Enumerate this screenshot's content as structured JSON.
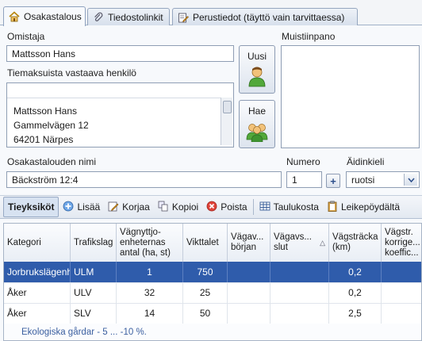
{
  "tabs": [
    {
      "label": "Osakastalous",
      "icon": "home-icon"
    },
    {
      "label": "Tiedostolinkit",
      "icon": "paperclip-icon"
    },
    {
      "label": "Perustiedot (täyttö vain tarvittaessa)",
      "icon": "edit-document-icon"
    }
  ],
  "owner": {
    "label": "Omistaja",
    "value": "Mattsson Hans"
  },
  "payer": {
    "label": "Tiemaksuista vastaava henkilö",
    "lines": [
      "Mattsson Hans",
      "Gammelvägen 12",
      "64201 Närpes"
    ]
  },
  "buttons": {
    "new": "Uusi",
    "fetch": "Hae"
  },
  "memo": {
    "label": "Muistiinpano",
    "value": ""
  },
  "household": {
    "label": "Osakastalouden nimi",
    "value": "Bäckström 12:4"
  },
  "number": {
    "label": "Numero",
    "value": "1"
  },
  "language": {
    "label": "Äidinkieli",
    "value": "ruotsi"
  },
  "toolbar": {
    "units": "Tieyksiköt",
    "add": "Lisää",
    "edit": "Korjaa",
    "copy": "Kopioi",
    "delete": "Poista",
    "from_table": "Taulukosta",
    "from_clipboard": "Leikepöydältä"
  },
  "grid": {
    "headers": [
      "Kategori",
      "Trafikslag",
      "Vägnyttjo-enheternas antal (ha, st)",
      "Vikttalet",
      "Vägav... början",
      "Vägavs... slut",
      "Vägsträcka (km)",
      "Vägstr. korrige... koeffic..."
    ],
    "rows": [
      [
        "Jorbrukslägenhet",
        "ULM",
        "1",
        "750",
        "",
        "",
        "0,2",
        ""
      ],
      [
        "Åker",
        "ULV",
        "32",
        "25",
        "",
        "",
        "0,2",
        ""
      ],
      [
        "Åker",
        "SLV",
        "14",
        "50",
        "",
        "",
        "2,5",
        ""
      ]
    ],
    "footer": "Ekologiska gårdar - 5 ... -10 %."
  },
  "colors": {
    "selected_row": "#2f5cab",
    "accent": "#3b5fa0"
  }
}
